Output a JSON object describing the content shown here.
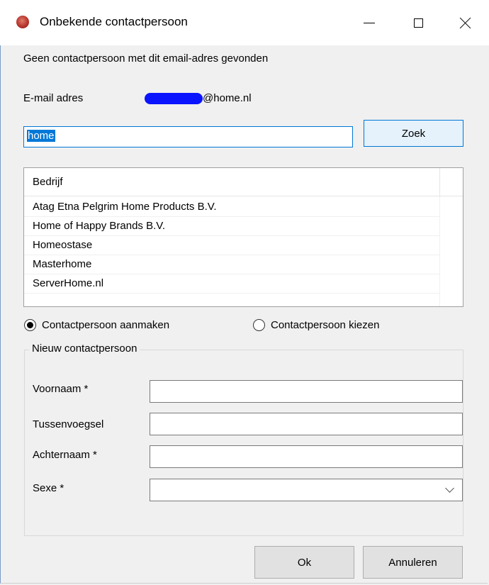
{
  "window": {
    "title": "Onbekende contactpersoon",
    "icon": "app-icon"
  },
  "message": "Geen contactpersoon met dit email-adres gevonden",
  "email": {
    "label": "E-mail adres",
    "domain_suffix": "@home.nl"
  },
  "search": {
    "value": "home",
    "button_label": "Zoek"
  },
  "results": {
    "header": "Bedrijf",
    "rows": [
      "Atag Etna  Pelgrim Home Products B.V.",
      "Home of Happy Brands B.V.",
      "Homeostase",
      "Masterhome",
      "ServerHome.nl"
    ]
  },
  "mode": {
    "create_label": "Contactpersoon aanmaken",
    "choose_label": "Contactpersoon kiezen",
    "selected": "create"
  },
  "new_contact": {
    "group_title": "Nieuw contactpersoon",
    "first_name_label": "Voornaam *",
    "middle_label": "Tussenvoegsel",
    "last_name_label": "Achternaam *",
    "sex_label": "Sexe *",
    "first_name_value": "",
    "middle_value": "",
    "last_name_value": "",
    "sex_value": ""
  },
  "buttons": {
    "ok": "Ok",
    "cancel": "Annuleren"
  },
  "colors": {
    "accent": "#0078d7",
    "redaction": "#0a14ff",
    "background": "#f0f0f0"
  }
}
